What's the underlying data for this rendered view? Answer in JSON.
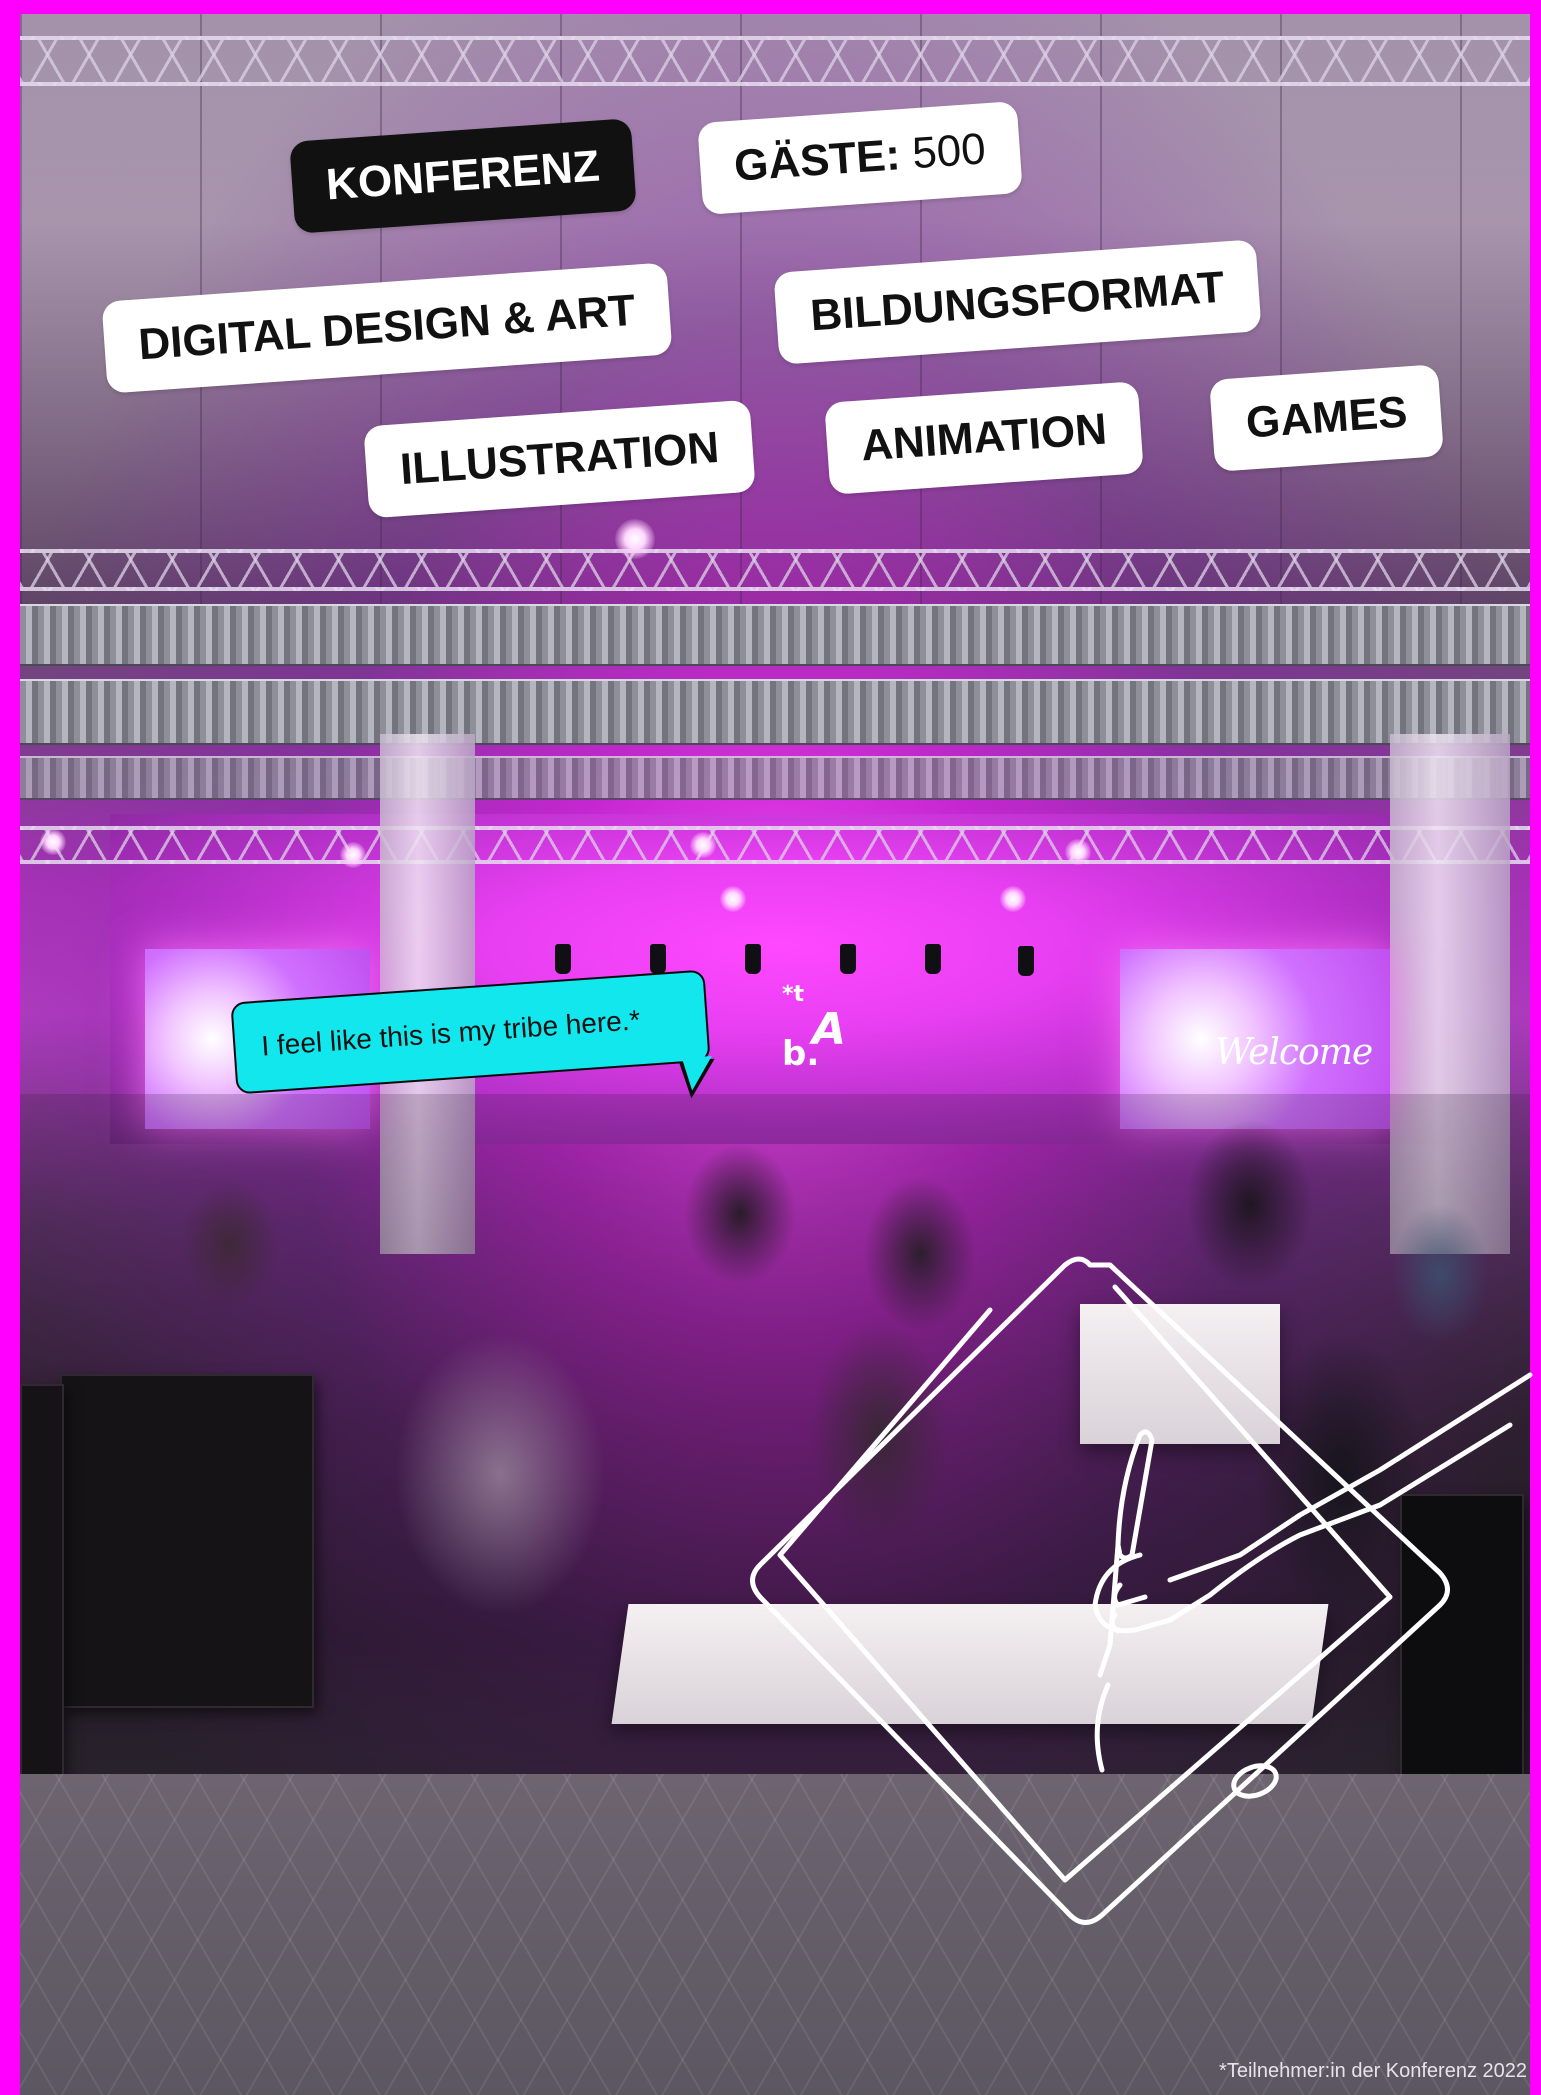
{
  "tags": {
    "konferenz": "KONFERENZ",
    "gaeste_label": "GÄSTE:",
    "gaeste_value": "500",
    "digital": "DIGITAL DESIGN & ART",
    "bildung": "BILDUNGSFORMAT",
    "illustration": "ILLUSTRATION",
    "animation": "ANIMATION",
    "games": "GAMES"
  },
  "bubble": {
    "quote": "I feel like this is my tribe here.*"
  },
  "scene": {
    "screen_text": "Welcome"
  },
  "footnote": "*Teilnehmer:in der Konferenz 2022",
  "colors": {
    "frame": "#ff00ff",
    "bubble": "#13e7ee",
    "tag_bg": "#ffffff",
    "tag_dark_bg": "#111111"
  },
  "icons": {
    "doodle": "hand-drawing-on-tablet-doodle",
    "logo": "conference-logo-mark"
  }
}
